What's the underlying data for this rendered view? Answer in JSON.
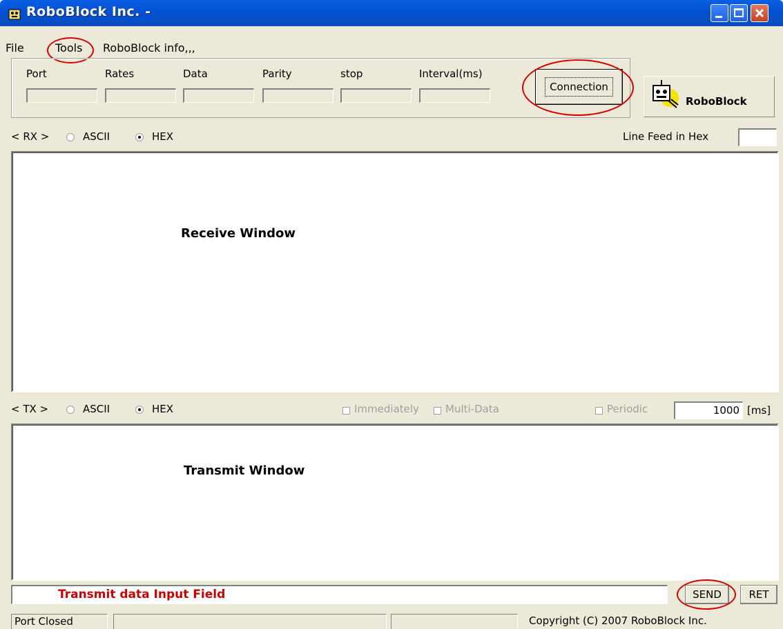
{
  "window": {
    "title": "RoboBlock Inc. -"
  },
  "menu": {
    "items": [
      "File",
      "Tools",
      "RoboBlock info,,,"
    ]
  },
  "settings": {
    "labels": [
      "Port",
      "Rates",
      "Data",
      "Parity",
      "stop",
      "Interval(ms)"
    ],
    "connect_label": "Connection"
  },
  "logo": {
    "label": "RoboBlock"
  },
  "rx": {
    "prefix": "< RX >",
    "ascii": "ASCII",
    "hex": "HEX",
    "selected": "HEX",
    "line_feed_label": "Line Feed in Hex",
    "window_label": "Receive Window"
  },
  "tx": {
    "prefix": "< TX >",
    "ascii": "ASCII",
    "hex": "HEX",
    "selected": "HEX",
    "immediately": "Immediately",
    "multi_data": "Multi-Data",
    "periodic": "Periodic",
    "interval_value": "1000",
    "interval_unit": "[ms]",
    "window_label": "Transmit Window"
  },
  "input": {
    "placeholder": "Transmit data Input Field",
    "send_label": "SEND",
    "ret_label": "RET"
  },
  "status": {
    "port": "Port Closed",
    "copyright": "Copyright (C) 2007 RoboBlock Inc."
  },
  "colors": {
    "titlebar": "#0450d0",
    "annotation": "#d40000"
  }
}
